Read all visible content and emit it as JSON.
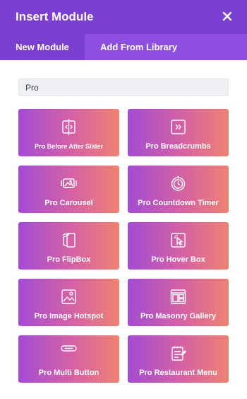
{
  "header": {
    "title": "Insert Module",
    "close_icon": "close-icon"
  },
  "tabs": [
    {
      "label": "New Module",
      "active": true
    },
    {
      "label": "Add From Library",
      "active": false
    }
  ],
  "search": {
    "value": "Pro"
  },
  "modules": [
    {
      "label": "Pro Before After Slider",
      "icon": "before-after-icon"
    },
    {
      "label": "Pro Breadcrumbs",
      "icon": "breadcrumbs-icon"
    },
    {
      "label": "Pro Carousel",
      "icon": "carousel-icon"
    },
    {
      "label": "Pro Countdown Timer",
      "icon": "countdown-timer-icon"
    },
    {
      "label": "Pro FlipBox",
      "icon": "flipbox-icon"
    },
    {
      "label": "Pro Hover Box",
      "icon": "hover-box-icon"
    },
    {
      "label": "Pro Image Hotspot",
      "icon": "image-hotspot-icon"
    },
    {
      "label": "Pro Masonry Gallery",
      "icon": "masonry-gallery-icon"
    },
    {
      "label": "Pro Multi Button",
      "icon": "multi-button-icon"
    },
    {
      "label": "Pro Restaurant Menu",
      "icon": "restaurant-menu-icon"
    }
  ],
  "colors": {
    "header": "#7b3fd1",
    "tabs": "#8e4fe0",
    "tile_gradient_start": "#a34cd4",
    "tile_gradient_end": "#ee8272"
  }
}
